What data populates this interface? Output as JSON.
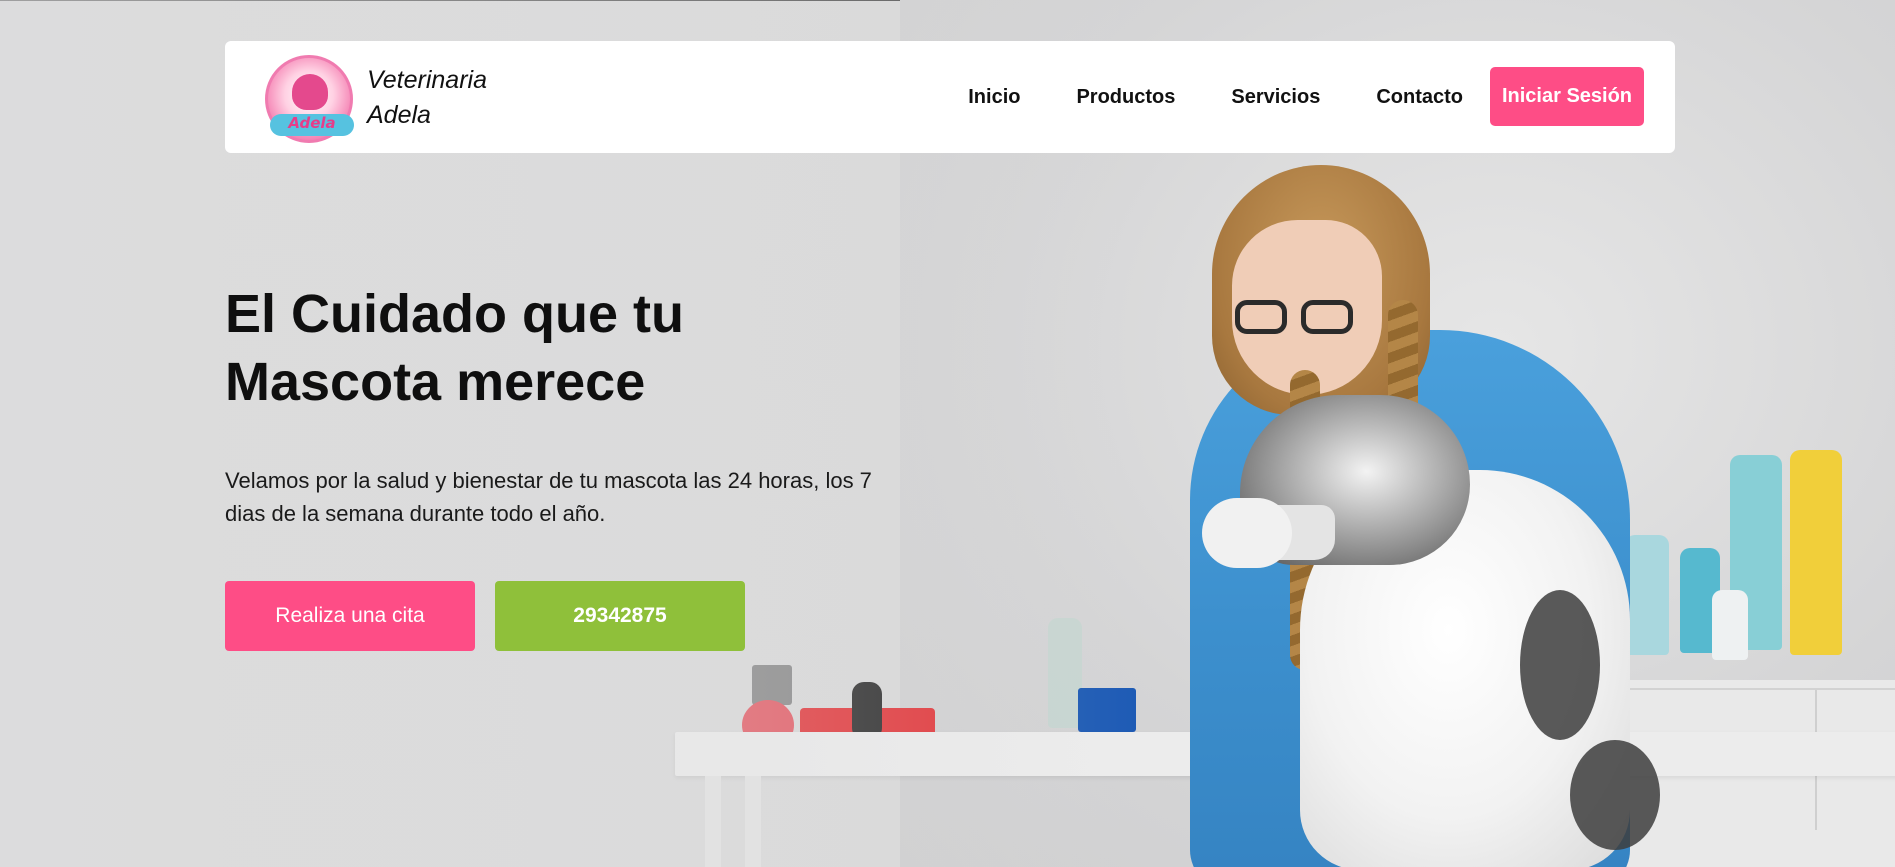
{
  "brand": {
    "name_line1": "Veterinaria",
    "name_line2": "Adela",
    "logo_text": "Adela",
    "colors": {
      "primary": "#fe4d86",
      "secondary": "#8fc03a"
    }
  },
  "nav": {
    "links": [
      "Inicio",
      "Productos",
      "Servicios",
      "Contacto"
    ],
    "login_label": "Iniciar Sesión"
  },
  "hero": {
    "title_line1": "El Cuidado que tu",
    "title_line2": "Mascota merece",
    "subtitle_line1": "Velamos por la salud y bienestar de tu mascota las 24 horas, los 7",
    "subtitle_line2": "dias de la semana durante todo el año.",
    "appointment_label": "Realiza una cita",
    "phone_label": "29342875",
    "image": "veterinarian-with-dog-photo"
  }
}
